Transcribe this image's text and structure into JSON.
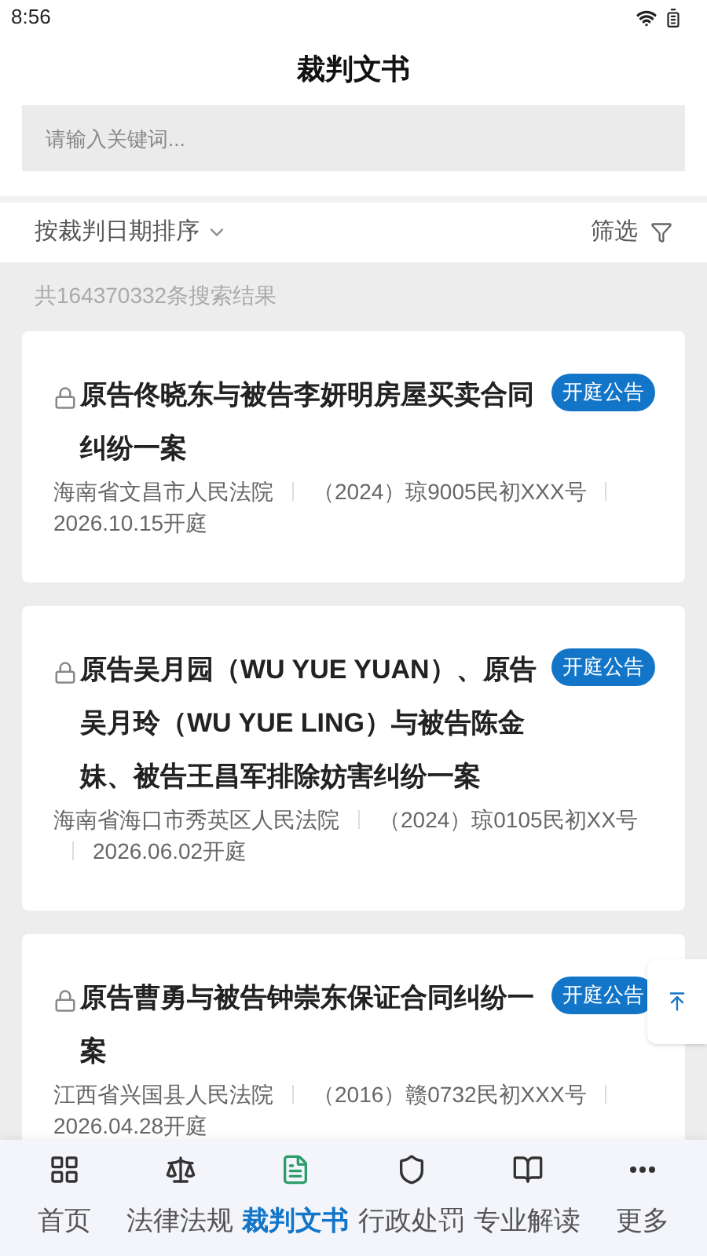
{
  "status_bar": {
    "time": "8:56"
  },
  "header": {
    "title": "裁判文书"
  },
  "search": {
    "placeholder": "请输入关键词..."
  },
  "sort": {
    "label": "按裁判日期排序"
  },
  "filter": {
    "label": "筛选"
  },
  "result_count": "共164370332条搜索结果",
  "cases": [
    {
      "title": "原告佟晓东与被告李妍明房屋买卖合同纠纷一案",
      "badge": "开庭公告",
      "meta": [
        "海南省文昌市人民法院",
        "（2024）琼9005民初XXX号",
        "2026.10.15开庭"
      ]
    },
    {
      "title": "原告吴月园（WU YUE YUAN）、原告吴月玲（WU YUE LING）与被告陈金妹、被告王昌军排除妨害纠纷一案",
      "badge": "开庭公告",
      "meta": [
        "海南省海口市秀英区人民法院",
        "（2024）琼0105民初XX号",
        "2026.06.02开庭"
      ]
    },
    {
      "title": "原告曹勇与被告钟崇东保证合同纠纷一案",
      "badge": "开庭公告",
      "meta": [
        "江西省兴国县人民法院",
        "（2016）赣0732民初XXX号",
        "2026.04.28开庭"
      ]
    }
  ],
  "bottom_nav": [
    {
      "kind": "grid",
      "label": "首页",
      "selected": false
    },
    {
      "kind": "scale",
      "label": "法律法规",
      "selected": false
    },
    {
      "kind": "doc",
      "label": "裁判文书",
      "selected": true
    },
    {
      "kind": "shield",
      "label": "行政处罚",
      "selected": false
    },
    {
      "kind": "book",
      "label": "专业解读",
      "selected": false
    },
    {
      "kind": "more",
      "label": "更多",
      "selected": false
    }
  ]
}
